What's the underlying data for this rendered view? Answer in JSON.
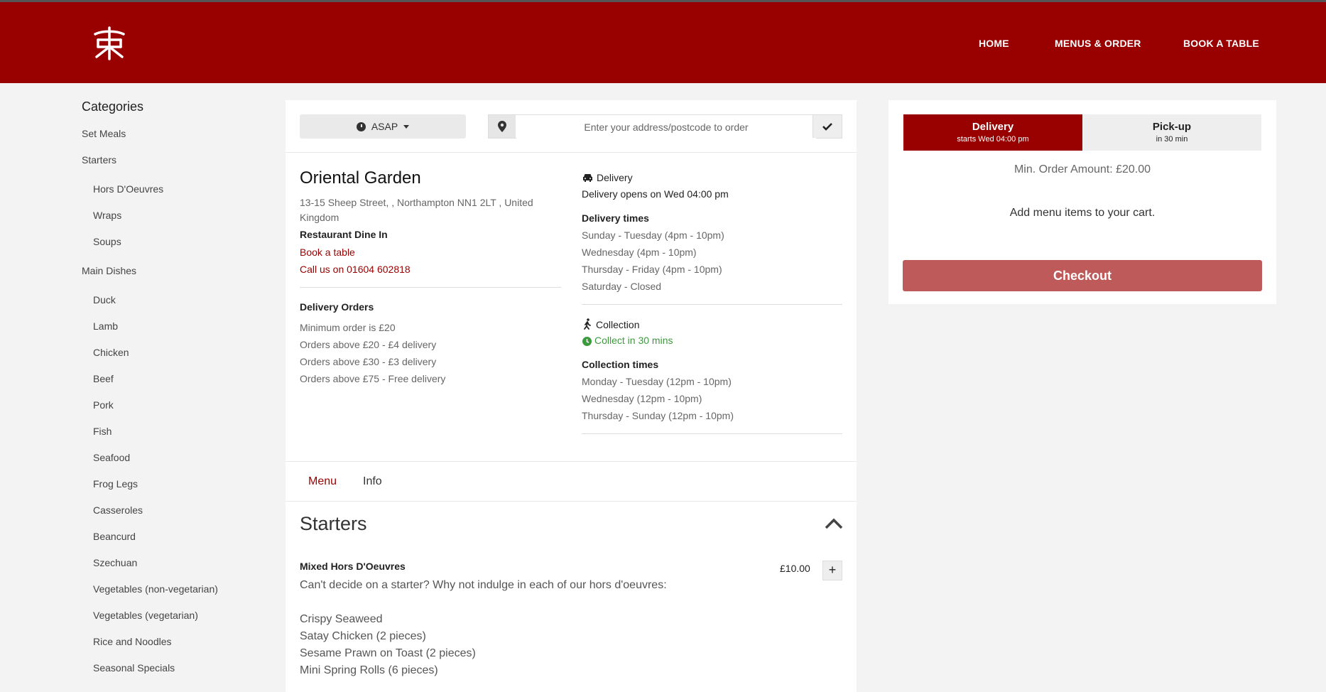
{
  "nav": {
    "home": "HOME",
    "menus": "MENUS & ORDER",
    "book": "BOOK A TABLE"
  },
  "sidebar": {
    "title": "Categories",
    "items": [
      {
        "label": "Set Meals",
        "level": "top"
      },
      {
        "label": "Starters",
        "level": "top"
      },
      {
        "label": "Hors D'Oeuvres",
        "level": "sub"
      },
      {
        "label": "Wraps",
        "level": "sub"
      },
      {
        "label": "Soups",
        "level": "sub"
      },
      {
        "label": "Main Dishes",
        "level": "top"
      },
      {
        "label": "Duck",
        "level": "sub"
      },
      {
        "label": "Lamb",
        "level": "sub"
      },
      {
        "label": "Chicken",
        "level": "sub"
      },
      {
        "label": "Beef",
        "level": "sub"
      },
      {
        "label": "Pork",
        "level": "sub"
      },
      {
        "label": "Fish",
        "level": "sub"
      },
      {
        "label": "Seafood",
        "level": "sub"
      },
      {
        "label": "Frog Legs",
        "level": "sub"
      },
      {
        "label": "Casseroles",
        "level": "sub"
      },
      {
        "label": "Beancurd",
        "level": "sub"
      },
      {
        "label": "Szechuan",
        "level": "sub"
      },
      {
        "label": "Vegetables (non-vegetarian)",
        "level": "sub"
      },
      {
        "label": "Vegetables (vegetarian)",
        "level": "sub"
      },
      {
        "label": "Rice and Noodles",
        "level": "sub"
      },
      {
        "label": "Seasonal Specials",
        "level": "sub"
      }
    ]
  },
  "order_bar": {
    "time_label": "ASAP",
    "address_placeholder": "Enter your address/postcode to order"
  },
  "restaurant": {
    "name": "Oriental Garden",
    "address": "13-15 Sheep Street, , Northampton NN1 2LT , United Kingdom",
    "dine_in": "Restaurant Dine In",
    "book_link": "Book a table",
    "call_link": "Call us on 01604 602818",
    "delivery_orders_title": "Delivery Orders",
    "delivery_orders": [
      "Minimum order is £20",
      "Orders above £20 - £4 delivery",
      "Orders above £30 - £3 delivery",
      "Orders above £75 - Free delivery"
    ]
  },
  "delivery": {
    "title": "Delivery",
    "status": "Delivery opens on Wed 04:00 pm",
    "times_title": "Delivery times",
    "times": [
      "Sunday - Tuesday (4pm - 10pm)",
      "Wednesday (4pm - 10pm)",
      "Thursday - Friday (4pm - 10pm)",
      "Saturday - Closed"
    ]
  },
  "collection": {
    "title": "Collection",
    "status": "Collect in 30 mins",
    "times_title": "Collection times",
    "times": [
      "Monday - Tuesday (12pm - 10pm)",
      "Wednesday (12pm - 10pm)",
      "Thursday - Sunday (12pm - 10pm)"
    ]
  },
  "tabs": {
    "menu": "Menu",
    "info": "Info"
  },
  "menu_section": {
    "title": "Starters",
    "item": {
      "name": "Mixed Hors D'Oeuvres",
      "price": "£10.00",
      "add_label": "+",
      "desc_intro": "Can't decide on a starter? Why not indulge in each of our hors d'oeuvres:",
      "desc_lines": [
        "Crispy Seaweed",
        "Satay Chicken (2 pieces)",
        "Sesame Prawn on Toast (2 pieces)",
        "Mini Spring Rolls (6 pieces)"
      ]
    }
  },
  "cart": {
    "delivery_label": "Delivery",
    "delivery_sub": "starts Wed 04:00 pm",
    "pickup_label": "Pick-up",
    "pickup_sub": "in 30 min",
    "min_order": "Min. Order Amount: £20.00",
    "empty_msg": "Add menu items to your cart.",
    "checkout": "Checkout"
  },
  "colors": {
    "brand": "#990000",
    "checkout": "#bf5a5a",
    "green": "#3c9a3c"
  }
}
